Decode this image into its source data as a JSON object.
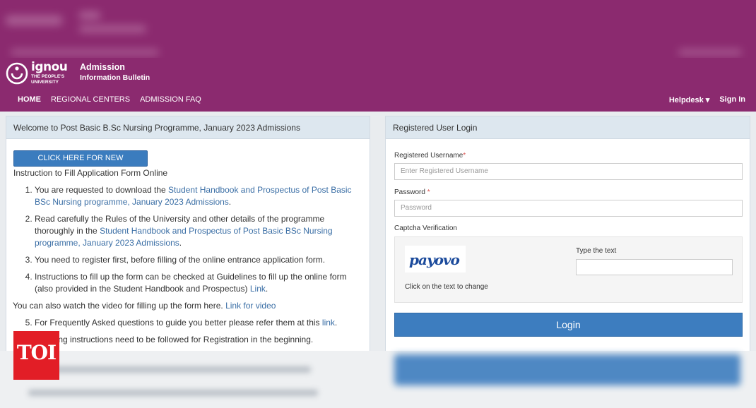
{
  "header": {
    "logo_word": "ignou",
    "logo_sub": "THE PEOPLE'S\nUNIVERSITY",
    "brand_title": "Admission",
    "brand_sub": "Information Bulletin",
    "nav": [
      "HOME",
      "REGIONAL CENTERS",
      "ADMISSION FAQ"
    ],
    "helpdesk": "Helpdesk ▾",
    "signin": "Sign In"
  },
  "left": {
    "title": "Welcome to Post Basic B.Sc Nursing Programme, January 2023 Admissions",
    "register_button": "CLICK HERE FOR NEW REGISTRATION",
    "instructions_title": "Instruction to Fill Application Form Online",
    "item1_text": "You are requested to download the ",
    "item1_link": "Student Handbook and Prospectus of Post Basic BSc Nursing programme, January 2023 Admissions",
    "item2_text": "Read carefully the Rules of the University and other details of the programme thoroughly in the ",
    "item2_link": "Student Handbook and Prospectus of Post Basic BSc Nursing programme, January 2023 Admissions",
    "item3_text": "You need to register first, before filling of the online entrance application form.",
    "item4_text": "Instructions to fill up the form can be checked at Guidelines to fill up the online form (also provided in the Student Handbook and Prospectus) ",
    "item4_link": "Link",
    "video_text": "You can also watch the video for filling up the form here. ",
    "video_link": "Link for video",
    "item5_text": "For Frequently Asked questions to guide you better please refer them at this ",
    "item5_link": "link",
    "item6_text": "...llowing instructions need to be followed for Registration in the beginning."
  },
  "login": {
    "title": "Registered User Login",
    "username_label": "Registered Username",
    "username_placeholder": "Enter Registered Username",
    "password_label": "Password",
    "password_placeholder": "Password",
    "captcha_label": "Captcha Verification",
    "captcha_text": "payovo",
    "captcha_hint": "Click on the text to change",
    "type_label": "Type the text",
    "login_button": "Login"
  },
  "watermark": {
    "text": "TOI",
    "color": "#e21e26"
  },
  "colors": {
    "header": "#8b2a6f",
    "primary": "#3d7dbf",
    "link": "#3a6ea5"
  }
}
